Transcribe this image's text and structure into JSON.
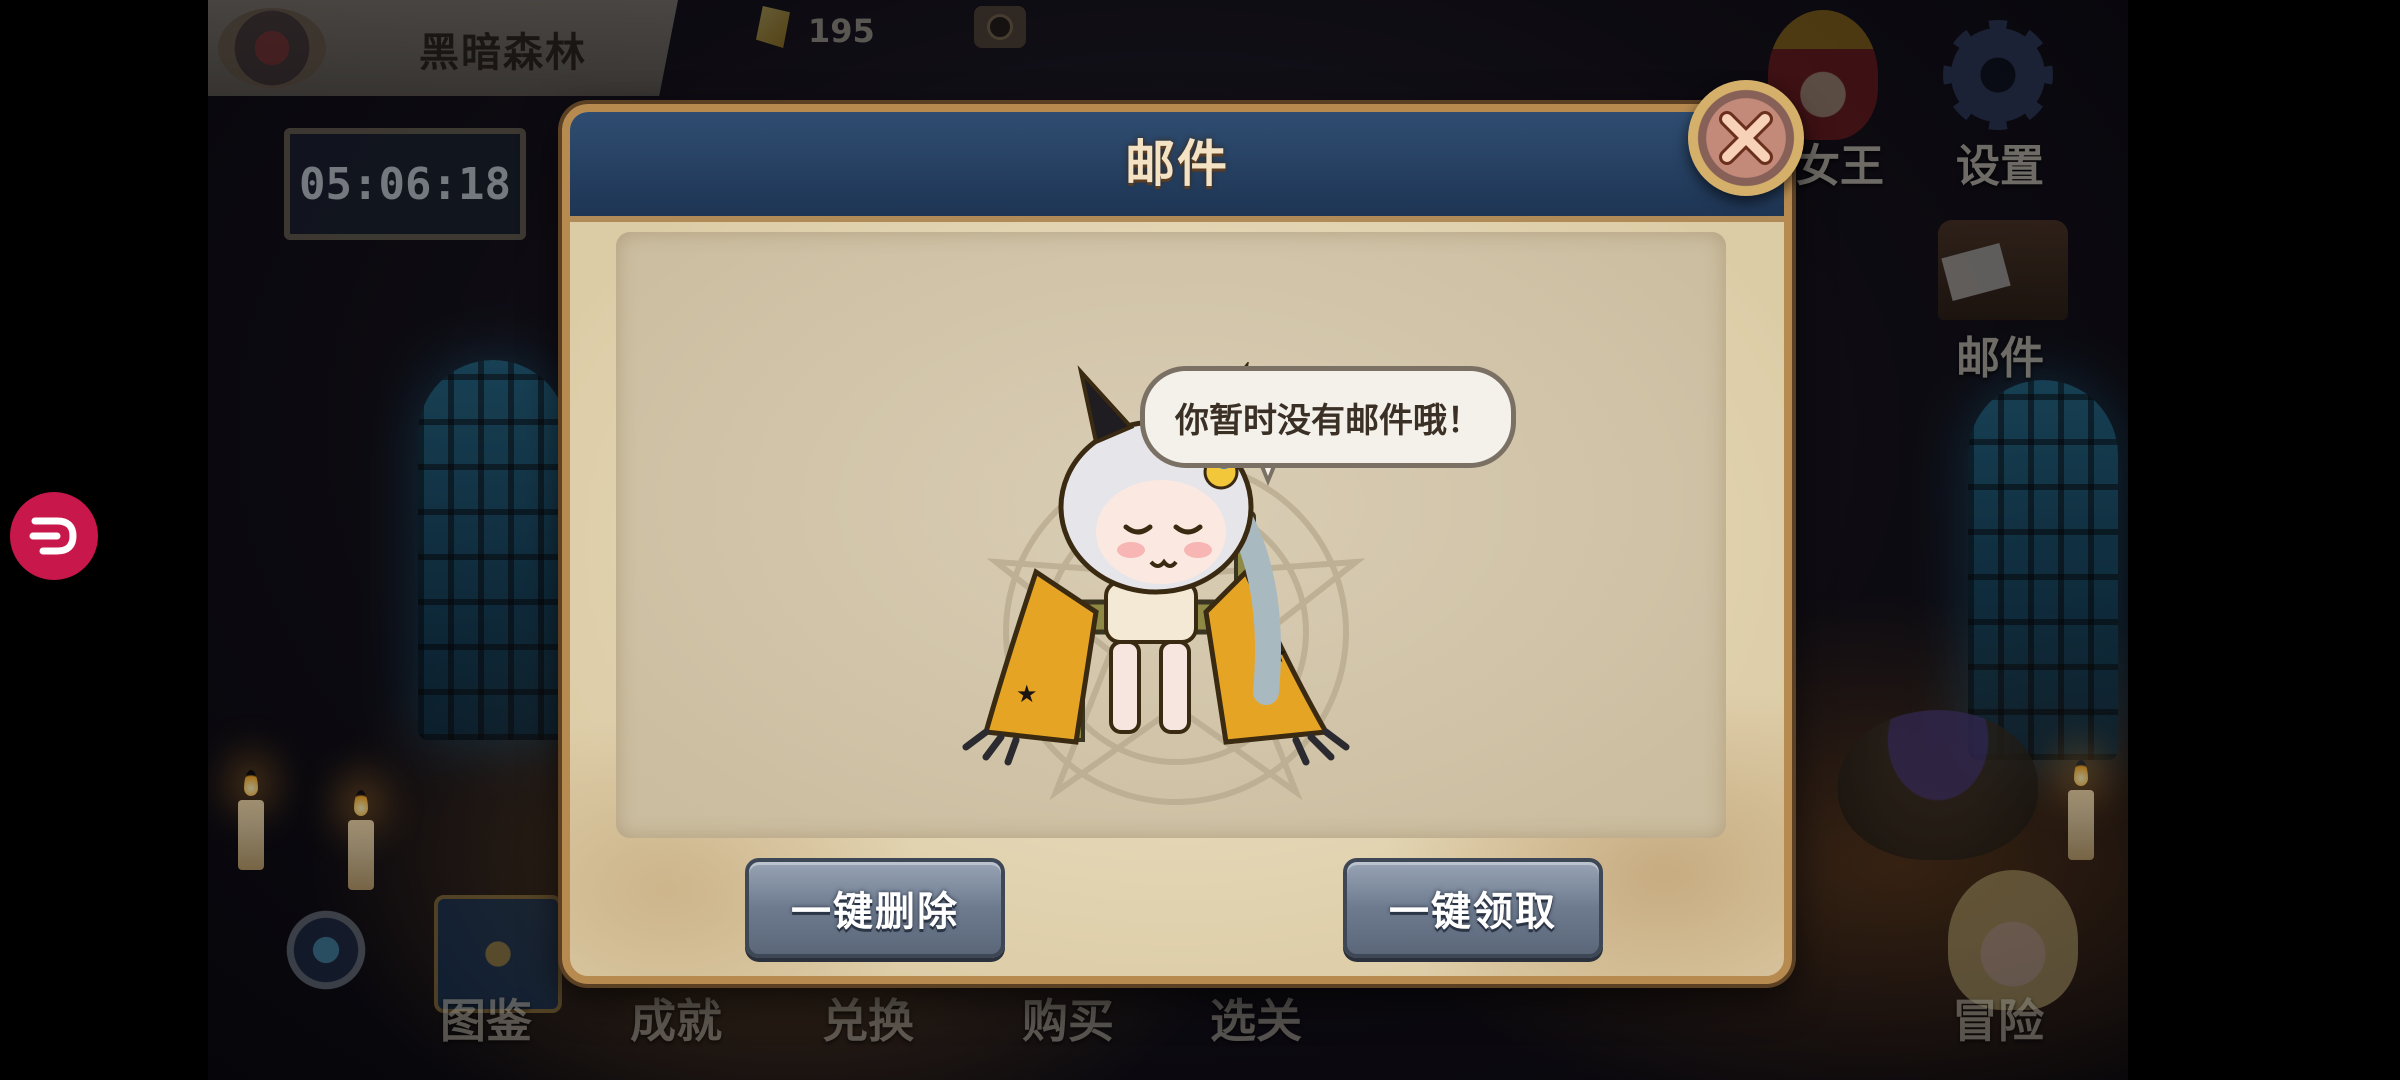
{
  "hud": {
    "location_name": "黑暗森林",
    "currency_value": "195",
    "timer": "05:06:18"
  },
  "side_menu": {
    "king_label": "女王",
    "settings_label": "设置",
    "mail_label": "邮件"
  },
  "bottom_nav": {
    "items": [
      "图鉴",
      "成就",
      "兑换",
      "购买",
      "选关",
      "冒险"
    ]
  },
  "mail_dialog": {
    "title": "邮件",
    "empty_message": "你暂时没有邮件哦！",
    "delete_all_label": "一键删除",
    "claim_all_label": "一键领取"
  },
  "icons": {
    "close": "close-icon",
    "settings": "gear-icon",
    "mail": "mailbox-icon",
    "currency": "crystal-icon",
    "camera": "camera-icon",
    "floating": "floating-assist-icon"
  },
  "colors": {
    "header_blue": "#2f4d71",
    "parchment": "#efe4c9",
    "button_gray": "#6e7b8f",
    "close_orange": "#f7d2b8",
    "float_button": "#c8174a"
  }
}
